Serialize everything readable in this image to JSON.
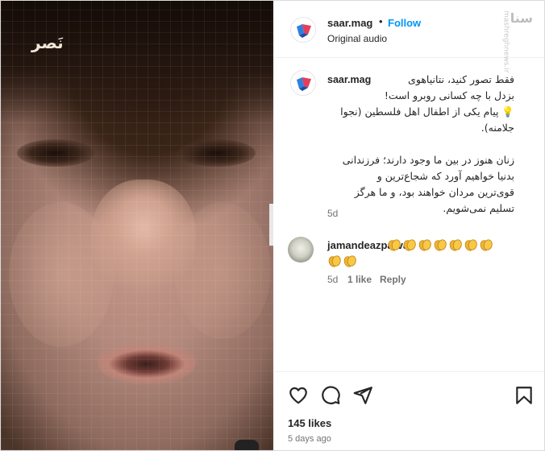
{
  "media": {
    "watermark_text": "نَصر"
  },
  "side_watermark": {
    "mark": "سنا",
    "site": "mashreghnews.ir"
  },
  "header": {
    "username": "saar.mag",
    "separator": "•",
    "follow_label": "Follow",
    "audio": "Original audio"
  },
  "caption": {
    "username": "saar.mag",
    "text": "فقط تصور کنید، نتانیاهوی\nبزدل با چه کسانی روبرو است!\n💡 پیام یکی از اطفال اهل فلسطین (نجوا\nجلامنه).\n\nزنان هنوز در بین ما وجود دارند؛ فرزندانی\nبدنیا خواهیم آورد که شجاع‌ترین و\nقوی‌ترین مردان خواهند بود، و ما هرگز\nتسلیم نمی‌شویم.",
    "time": "5d"
  },
  "comment": {
    "username": "jamandeazparvaz",
    "time": "5d",
    "likes": "1 like",
    "reply_label": "Reply",
    "clap_count": 9
  },
  "actions": {
    "like_icon": "heart-icon",
    "comment_icon": "comment-icon",
    "share_icon": "share-icon",
    "save_icon": "bookmark-icon"
  },
  "footer": {
    "likes": "145 likes",
    "time_ago": "5 days ago"
  },
  "colors": {
    "accent": "#0095f6",
    "muted": "#737373",
    "text": "#262626"
  }
}
